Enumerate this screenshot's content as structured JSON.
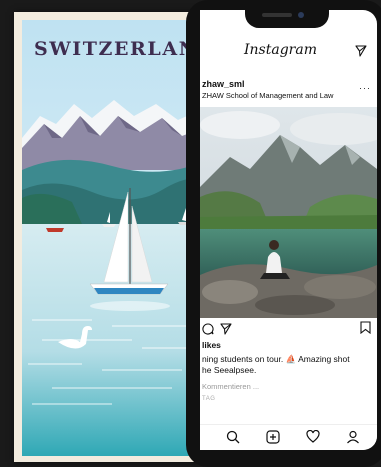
{
  "poster": {
    "title": "SWITZERLAND"
  },
  "instagram": {
    "app_name": "Instagram",
    "post": {
      "username": "zhaw_sml",
      "location": "ZHAW School of Management and Law",
      "more": "···",
      "likes": "likes",
      "caption_line1": "ning students on tour. ⛵ Amazing shot",
      "caption_line2": "he Seealpsee.",
      "comment_placeholder": "Kommentieren ...",
      "time_ago": "TAG"
    },
    "icons": {
      "header_right": "send-icon",
      "actions": [
        "comment-icon",
        "share-icon",
        "bookmark-icon"
      ],
      "nav": [
        "search-icon",
        "add-post-icon",
        "heart-icon",
        "profile-icon"
      ]
    }
  },
  "colors": {
    "poster_sky": "#cfe8f3",
    "poster_lake": "#cde7ee",
    "poster_title": "#3e2d4f",
    "ig_background": "#ffffff",
    "phone_frame": "#111111"
  }
}
